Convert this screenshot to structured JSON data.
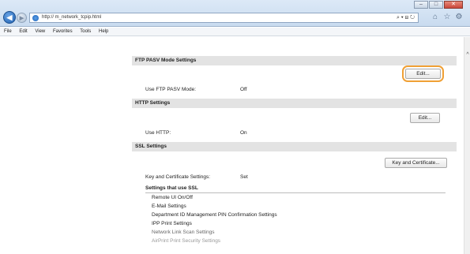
{
  "browser": {
    "url": "http://                    m_network_tcpip.html",
    "addr_controls": "⌕ ▾ ⊟ ↻",
    "menu": [
      "File",
      "Edit",
      "View",
      "Favorites",
      "Tools",
      "Help"
    ],
    "window_controls": [
      "–",
      "□",
      "✕"
    ]
  },
  "page": {
    "ftp": {
      "title": "FTP PASV Mode Settings",
      "edit_label": "Edit...",
      "row_label": "Use FTP PASV Mode:",
      "row_value": "Off"
    },
    "http": {
      "title": "HTTP Settings",
      "edit_label": "Edit...",
      "row_label": "Use HTTP:",
      "row_value": "On"
    },
    "ssl": {
      "title": "SSL Settings",
      "button_label": "Key and Certificate...",
      "row_label": "Key and Certificate Settings:",
      "row_value": "Set",
      "subhead": "Settings that use SSL",
      "links": [
        "Remote UI On/Off",
        "E-Mail Settings",
        "Department ID Management PIN Confirmation Settings",
        "IPP Print Settings",
        "Network Link Scan Settings",
        "AirPrint Print Security Settings"
      ]
    }
  },
  "colors": {
    "highlight": "#f0a035",
    "section_bg": "#e3e3e3"
  }
}
